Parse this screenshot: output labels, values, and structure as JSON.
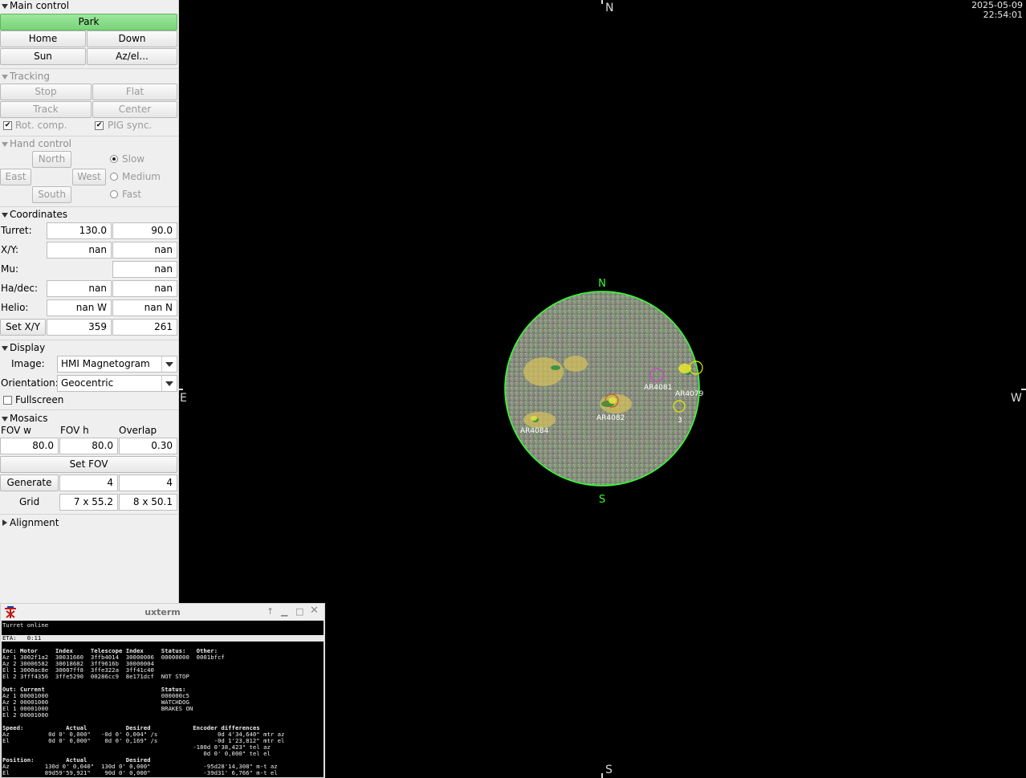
{
  "main_control": {
    "title": "Main control",
    "park": "Park",
    "home": "Home",
    "down": "Down",
    "sun": "Sun",
    "azel": "Az/el..."
  },
  "tracking": {
    "title": "Tracking",
    "stop": "Stop",
    "flat": "Flat",
    "track": "Track",
    "center": "Center",
    "rot_comp": "Rot. comp.",
    "pig_sync": "PIG sync."
  },
  "hand_control": {
    "title": "Hand control",
    "north": "North",
    "east": "East",
    "west": "West",
    "south": "South",
    "speed_slow": "Slow",
    "speed_medium": "Medium",
    "speed_fast": "Fast",
    "selected_speed": "Slow"
  },
  "coordinates": {
    "title": "Coordinates",
    "turret_label": "Turret:",
    "turret_a": "130.0",
    "turret_b": "90.0",
    "xy_label": "X/Y:",
    "xy_a": "nan",
    "xy_b": "nan",
    "mu_label": "Mu:",
    "mu_b": "nan",
    "hadec_label": "Ha/dec:",
    "hadec_a": "nan",
    "hadec_b": "nan",
    "helio_label": "Helio:",
    "helio_a": "nan W",
    "helio_b": "nan N",
    "setxy_button": "Set X/Y",
    "setxy_a": "359",
    "setxy_b": "261"
  },
  "display": {
    "title": "Display",
    "image_label": "Image:",
    "image_value": "HMI Magnetogram",
    "orientation_label": "Orientation:",
    "orientation_value": "Geocentric",
    "fullscreen": "Fullscreen"
  },
  "mosaics": {
    "title": "Mosaics",
    "fov_w_label": "FOV w",
    "fov_h_label": "FOV h",
    "overlap_label": "Overlap",
    "fov_w": "80.0",
    "fov_h": "80.0",
    "overlap": "0.30",
    "set_fov": "Set FOV",
    "generate": "Generate",
    "gen_a": "4",
    "gen_b": "4",
    "grid_label": "Grid",
    "grid_a": "7 x  55.2",
    "grid_b": "8 x  50.1"
  },
  "alignment": {
    "title": "Alignment"
  },
  "view": {
    "north": "N",
    "south": "S",
    "east": "E",
    "west": "W",
    "date": "2025-05-09",
    "time": "22:54:01",
    "disk_north": "N",
    "disk_south": "S",
    "regions": [
      "AR4081",
      "AR4079",
      "AR4082",
      "AR4084",
      "3"
    ],
    "colors": {
      "limb": "#33ff33",
      "label": "#ffffff",
      "region_marker": "#e8e800"
    }
  },
  "xterm": {
    "title": "uxterm",
    "lines": [
      "Turret online",
      "",
      "ETA:   0:11",
      "",
      "Enc: Motor     Index     Telescope Index     Status:   Other:",
      "Az 1 3002f1a2  30031660  3ffb4014  30000006  00000000  0001bfcf",
      "Az 2 30006582  30018682  3ff9616b  30000004",
      "El 1 3000ac8e  30007ff8  3ffe322a  3ff41c40",
      "El 2 3fff4356  3ffe5290  00286cc9  8e171dcf  NOT STOP",
      "",
      "Out: Current                                 Status:",
      "Az 1 00001000                                000000c5",
      "Az 2 00001000                                WATCHDOG",
      "El 1 00001000                                BRAKES ON",
      "El 2 00001000",
      "",
      "Speed:            Actual           Desired            Encoder differences",
      "Az           0d 0' 0,000\"   -0d 0' 0,004\" /s                 0d 4'34,640\" mtr az",
      "El           0d 0' 0,000\"    0d 0' 0,169\" /s                -0d 1'23,812\" mtr el",
      "                                                      -180d 0'38,423\" tel az",
      "                                                         0d 0' 0,000\" tel el",
      "Position:         Actual           Desired",
      "Az          130d 0' 0,040\"  130d 0' 0,000\"               -95d28'14,308\" m-t az",
      "El          89d59'59,921\"    90d 0' 0,000\"               -39d31' 6,766\" m-t el"
    ]
  }
}
